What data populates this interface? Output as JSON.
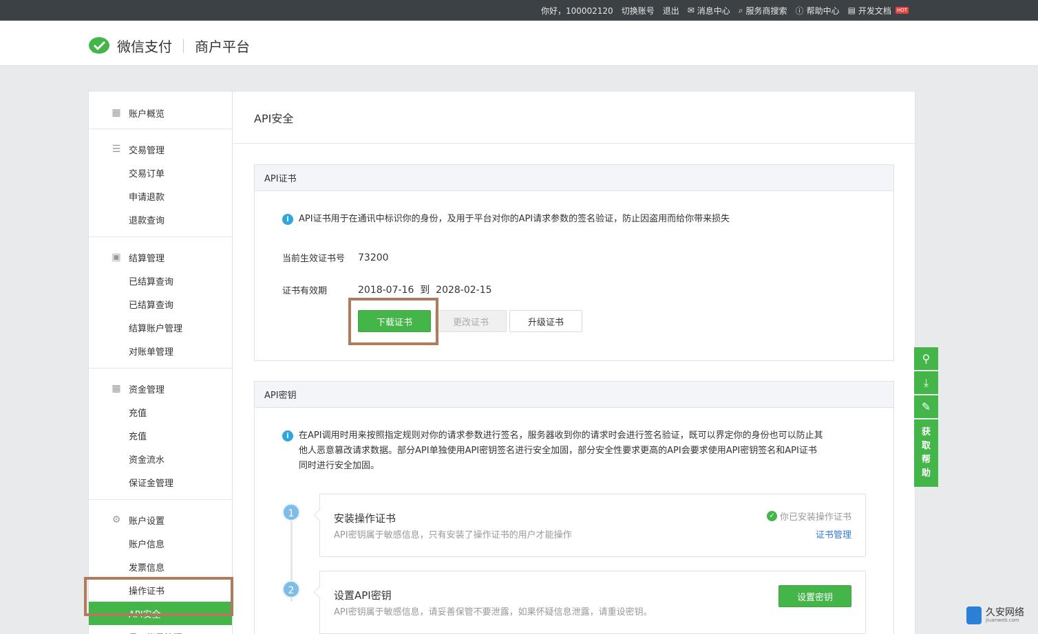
{
  "topbar": {
    "greeting": "你好，100002120",
    "switch_account": "切换账号",
    "logout": "退出",
    "message_center": "消息中心",
    "provider_search": "服务商搜索",
    "help_center": "帮助中心",
    "dev_docs": "开发文档",
    "hot_badge": "HOT"
  },
  "header": {
    "brand": "微信支付",
    "platform": "商户平台"
  },
  "sidebar": {
    "overview": "账户概览",
    "trade": {
      "title": "交易管理",
      "items": [
        "交易订单",
        "申请退款",
        "退款查询"
      ]
    },
    "settle": {
      "title": "结算管理",
      "items": [
        "已结算查询",
        "已结算查询",
        "结算账户管理",
        "对账单管理"
      ]
    },
    "funds": {
      "title": "资金管理",
      "items": [
        "充值",
        "充值",
        "资金流水",
        "保证金管理"
      ]
    },
    "account": {
      "title": "账户设置",
      "items": [
        "账户信息",
        "发票信息",
        "操作证书",
        "API安全",
        "员工帐号管理"
      ]
    }
  },
  "main": {
    "title": "API安全",
    "cert": {
      "head": "API证书",
      "info": "API证书用于在通讯中标识你的身份，及用于平台对你的API请求参数的签名验证，防止因盗用而给你带来损失",
      "serial_label": "当前生效证书号",
      "serial_value": "73200",
      "validity_label": "证书有效期",
      "validity_value": "2018-07-16  到  2028-02-15",
      "download_btn": "下载证书",
      "change_btn": "更改证书",
      "upgrade_btn": "升级证书"
    },
    "key": {
      "head": "API密钥",
      "info_line1": "在API调用时用来按照指定规则对你的请求参数进行签名，服务器收到你的请求时会进行签名验证，既可以界定你的身份也可以防止其",
      "info_line2": "他人恶意篡改请求数据。部分API单独使用API密钥签名进行安全加固，部分安全性要求更高的API会要求使用API密钥签名和API证书",
      "info_line3": "同时进行安全加固。",
      "step1": {
        "num": "1",
        "title": "安装操作证书",
        "desc": "API密钥属于敏感信息，只有安装了操作证书的用户才能操作",
        "status": "你已安装操作证书",
        "link": "证书管理"
      },
      "step2": {
        "num": "2",
        "title": "设置API密钥",
        "desc": "API密钥属于敏感信息，请妥善保管不要泄露，如果怀疑信息泄露，请重设密钥。",
        "button": "设置密钥"
      }
    }
  },
  "float": {
    "help_chars": [
      "获",
      "取",
      "帮",
      "助"
    ]
  },
  "watermark": {
    "name": "久安网络",
    "url": "jiuanweb.com"
  }
}
